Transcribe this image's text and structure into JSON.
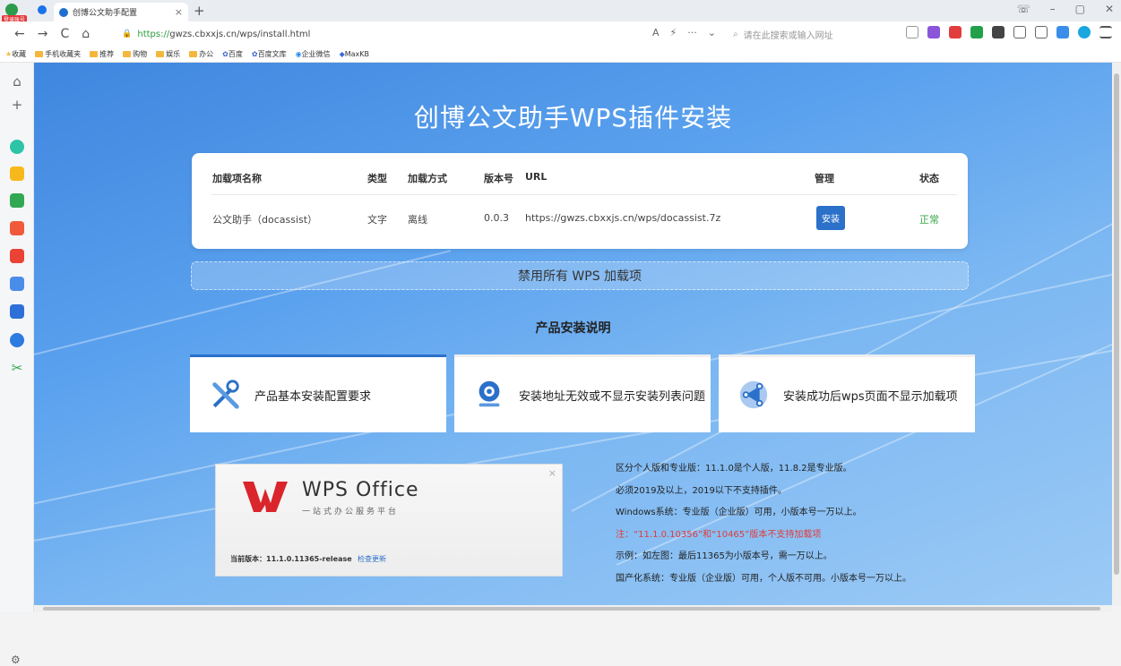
{
  "browser": {
    "tab_title": "创博公文助手配置",
    "tab_close": "×",
    "new_tab": "+",
    "badge": "登录账号",
    "url_prefix": "https://",
    "url_rest": "gwzs.cbxxjs.cn/wps/install.html",
    "search_placeholder": "请在此搜索或输入网址",
    "nav": {
      "back": "←",
      "forward": "→",
      "reload": "C",
      "home": "⌂"
    },
    "window_controls": [
      "☏",
      "–",
      "▢",
      "✕"
    ],
    "bookmarks": [
      "收藏",
      "手机收藏夹",
      "推荐",
      "购物",
      "娱乐",
      "办公",
      "百度",
      "百度文库",
      "企业微信",
      "MaxKB"
    ]
  },
  "page": {
    "title": "创博公文助手WPS插件安装",
    "table": {
      "headers": {
        "name": "加载项名称",
        "type": "类型",
        "mode": "加载方式",
        "version": "版本号",
        "url": "URL",
        "manage": "管理",
        "status": "状态"
      },
      "row": {
        "name": "公文助手（docassist）",
        "type": "文字",
        "mode": "离线",
        "version": "0.0.3",
        "url": "https://gwzs.cbxxjs.cn/wps/docassist.7z",
        "button": "安装",
        "status": "正常"
      }
    },
    "disable_all": "禁用所有 WPS 加载项",
    "section_title": "产品安装说明",
    "boxes": [
      "产品基本安装配置要求",
      "安装地址无效或不显示安装列表问题",
      "安装成功后wps页面不显示加载项"
    ],
    "wps": {
      "brand": "WPS Office",
      "subtitle": "一站式办公服务平台",
      "version": "当前版本：11.1.0.11365-release",
      "update": "检查更新",
      "close": "×"
    },
    "notes": [
      "区分个人版和专业版：11.1.0是个人版，11.8.2是专业版。",
      "必须2019及以上，2019以下不支持插件。",
      "Windows系统：专业版（企业版）可用，小版本号一万以上。",
      "注：“11.1.0.10356”和“10465”版本不支持加载项",
      "示例：如左图：最后11365为小版本号，需一万以上。",
      "国产化系统：专业版（企业版）可用，个人版不可用。小版本号一万以上。"
    ]
  },
  "colors": {
    "primary": "#2b70c9",
    "ok": "#3aa64a",
    "warn": "#e03b3b",
    "wps_red": "#d9252b"
  }
}
